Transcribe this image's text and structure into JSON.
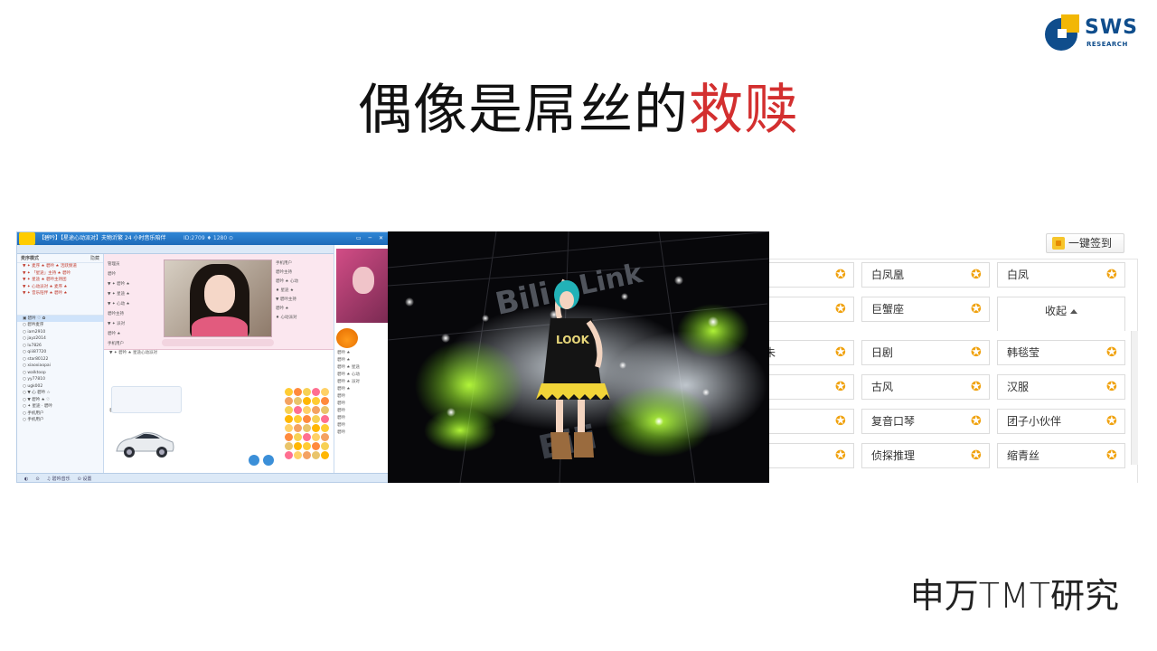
{
  "slide": {
    "title_main": "偶像是屌丝的",
    "title_highlight": "救赎",
    "footer": "申万TMT研究"
  },
  "logo": {
    "word": "SWS",
    "sub": "RESEARCH",
    "colors": {
      "blue": "#0f4d8c",
      "yellow": "#f2b705"
    }
  },
  "chat_app": {
    "title": "【碧吟】【星途心动派对】夫物沂繁 24 小时音乐陪伴",
    "stats": "ID:2709  ♦ 1280  ⊙",
    "window_buttons": "▭ ─ ✕",
    "left_header": "麦序模式",
    "left_header_right": "隐藏",
    "tree": [
      {
        "text": "▼ ✦ 麦序 ★ 碧吟 ★ 活跃频道",
        "red": true
      },
      {
        "text": "▼ ✦ 「星途」主持 ★ 碧吟",
        "red": true
      },
      {
        "text": "▼ ✦ 星途 ★ 碧吟主持团",
        "red": true
      },
      {
        "text": "▼ ✦ 心动派对 ★ 麦序 ★",
        "red": true
      },
      {
        "text": "▼ ✦ 音乐陪伴 ★ 碧吟 ★",
        "red": true
      }
    ],
    "users": [
      {
        "text": "▣ 碧吟 ♡ ✿",
        "sel": true
      },
      {
        "text": "○ 碧吟麦序"
      },
      {
        "text": "○ iam2910"
      },
      {
        "text": "○ jayz2014"
      },
      {
        "text": "○ lu7826"
      },
      {
        "text": "○ qiii87720"
      },
      {
        "text": "○ star80122"
      },
      {
        "text": "○ xiaoxiaopai"
      },
      {
        "text": "○ walktoop"
      },
      {
        "text": "○ yy77810"
      },
      {
        "text": "○ ugk002"
      },
      {
        "text": "○ ▼ 心 碧吟 ☆"
      },
      {
        "text": "○ ▼ 碧吟 ★ ♡"
      },
      {
        "text": "○ ✦ 星途 · 碧吟"
      },
      {
        "text": "○ 手机用户"
      },
      {
        "text": "○ 手机用户"
      }
    ],
    "stage_users": [
      "管理员",
      "碧吟",
      "▼ ✦ 碧吟 ★",
      "▼ ✦ 星途 ★",
      "▼ ✦ 心动 ★",
      "碧吟主持",
      "▼ ✦ 派对",
      "碧吟 ★",
      "手机用户"
    ],
    "stage_right": [
      "手机用户",
      "碧吟主持",
      "碧吟 ★ 心动",
      "♦ 星途 ★",
      "▼ 碧吟主持",
      "碧吟 ★",
      "♦ 心动派对"
    ],
    "chat_msgs": [
      "▼ ✦ 碧吟 ★ 星途心动派对",
      "",
      "",
      "",
      "",
      "",
      "",
      "",
      "碧吟：欢迎来到星途"
    ],
    "right_msgs": [
      "碧吟 ★",
      "碧吟 ★",
      "碧吟 ★ 星途",
      "碧吟 ★ 心动",
      "碧吟 ★ 派对",
      "碧吟 ★",
      "碧吟",
      "碧吟",
      "碧吟",
      "碧吟",
      "碧吟",
      "碧吟"
    ],
    "status_items": [
      "◐",
      "⊙",
      "♫ 碧吟音乐",
      "⊙ 设置"
    ]
  },
  "tags": {
    "checkin_label": "一键签到",
    "collapse_label": "收起",
    "rows": [
      [
        "",
        "白凤凰",
        "白凤"
      ],
      [
        "",
        "巨蟹座"
      ],
      [
        "未",
        "日剧",
        "韩毯莹"
      ],
      [
        "",
        "古风",
        "汉服"
      ],
      [
        "",
        "复音口琴",
        "团子小伙伴"
      ],
      [
        "",
        "侦探推理",
        "缩青丝"
      ]
    ],
    "star_color": "#f0a20f"
  },
  "colors": {
    "highlight": "#d32f2f",
    "title": "#111111"
  }
}
